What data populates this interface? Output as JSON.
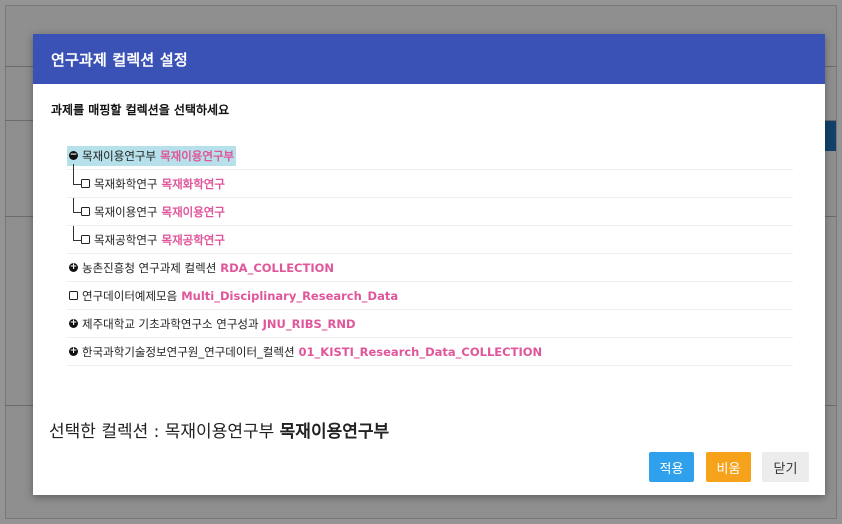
{
  "dialog": {
    "title": "연구과제 컬렉션 설정",
    "subtitle": "과제를 매핑할 컬렉션을 선택하세요"
  },
  "tree": [
    {
      "name": "목재이용연구부",
      "code": "목재이용연구부",
      "icon": "minus-circle-icon",
      "selected": true
    },
    {
      "name": "목재화학연구",
      "code": "목재화학연구",
      "icon": "checkbox-icon",
      "child": true
    },
    {
      "name": "목재이용연구",
      "code": "목재이용연구",
      "icon": "checkbox-icon",
      "child": true
    },
    {
      "name": "목재공학연구",
      "code": "목재공학연구",
      "icon": "checkbox-icon",
      "child": true
    },
    {
      "name": "농촌진흥청 연구과제 컬렉션",
      "code": "RDA_COLLECTION",
      "icon": "plus-circle-icon"
    },
    {
      "name": "연구데이터예제모음",
      "code": "Multi_Disciplinary_Research_Data",
      "icon": "checkbox-icon"
    },
    {
      "name": "제주대학교 기초과학연구소 연구성과",
      "code": "JNU_RIBS_RND",
      "icon": "plus-circle-icon"
    },
    {
      "name": "한국과학기술정보연구원_연구데이터_컬렉션",
      "code": "01_KISTI_Research_Data_COLLECTION",
      "icon": "plus-circle-icon"
    }
  ],
  "selection": {
    "label": "선택한 컬렉션 : 목재이용연구부",
    "code": "목재이용연구부"
  },
  "buttons": {
    "apply": "적용",
    "clear": "비움",
    "close": "닫기"
  },
  "colors": {
    "header": "#3a52b5",
    "code_text": "#e0569b",
    "selected_bg": "#b6e1ea",
    "apply_button": "#2fa0ec",
    "clear_button": "#f6a21a",
    "close_button": "#ececec"
  }
}
